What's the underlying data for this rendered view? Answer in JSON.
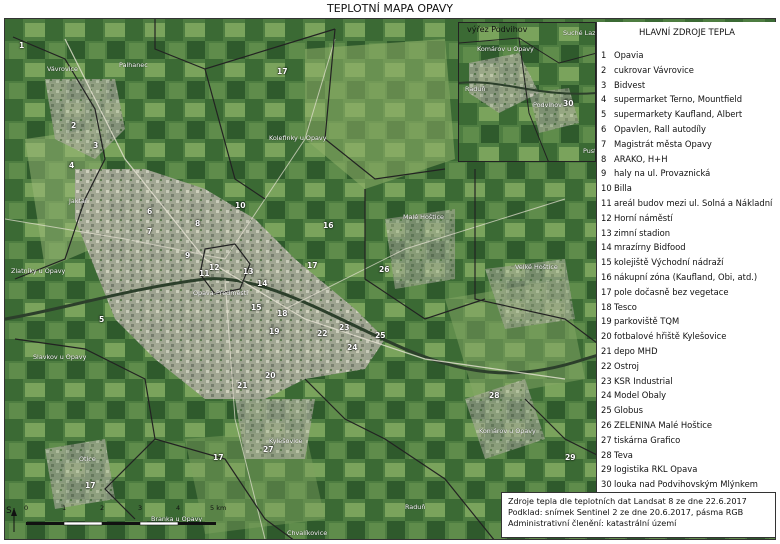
{
  "title": "TEPLOTNÍ MAPA OPAVY",
  "legend": {
    "title": "HLAVNÍ ZDROJE TEPLA",
    "items": [
      {
        "n": "1",
        "label": "Opavia"
      },
      {
        "n": "2",
        "label": "cukrovar Vávrovice"
      },
      {
        "n": "3",
        "label": "Bidvest"
      },
      {
        "n": "4",
        "label": "supermarket Terno, Mountfield"
      },
      {
        "n": "5",
        "label": "supermarkety Kaufland, Albert"
      },
      {
        "n": "6",
        "label": "Opavlen, Rall autodíly"
      },
      {
        "n": "7",
        "label": "Magistrát města Opavy"
      },
      {
        "n": "8",
        "label": "ARAKO, H+H"
      },
      {
        "n": "9",
        "label": "haly na ul. Provaznická"
      },
      {
        "n": "10",
        "label": "Billa"
      },
      {
        "n": "11",
        "label": "areál budov mezi ul. Solná a Nákladní"
      },
      {
        "n": "12",
        "label": "Horní náměstí"
      },
      {
        "n": "13",
        "label": "zimní stadion"
      },
      {
        "n": "14",
        "label": "mrazírny Bidfood"
      },
      {
        "n": "15",
        "label": "kolejiště Východní nádraží"
      },
      {
        "n": "16",
        "label": "nákupní zóna (Kaufland, Obi, atd.)"
      },
      {
        "n": "17",
        "label": "pole dočasně bez vegetace"
      },
      {
        "n": "18",
        "label": "Tesco"
      },
      {
        "n": "19",
        "label": "parkoviště TQM"
      },
      {
        "n": "20",
        "label": "fotbalové hřiště Kylešovice"
      },
      {
        "n": "21",
        "label": "depo MHD"
      },
      {
        "n": "22",
        "label": "Ostroj"
      },
      {
        "n": "23",
        "label": "KSR Industrial"
      },
      {
        "n": "24",
        "label": "Model Obaly"
      },
      {
        "n": "25",
        "label": "Globus"
      },
      {
        "n": "26",
        "label": "ZELENINA Malé Hoštice"
      },
      {
        "n": "27",
        "label": "tiskárna Grafico"
      },
      {
        "n": "28",
        "label": "Teva"
      },
      {
        "n": "29",
        "label": "logistika RKL Opava"
      },
      {
        "n": "30",
        "label": "louka nad Podvihovským Mlýnkem"
      }
    ]
  },
  "inset": {
    "title": "výřez Podvihov",
    "places": [
      "Komárov u Opavy",
      "Raduň",
      "Podvihov",
      "Suché Lazce",
      "Pust"
    ],
    "marker": "30"
  },
  "note": {
    "line1": "Zdroje tepla dle teplotních dat Landsat 8 ze dne 22.6.2017",
    "line2": "Podklad: snímek Sentinel 2 ze dne 20.6.2017, pásma RGB",
    "line3": "Administrativní členění: katastrální území"
  },
  "places": {
    "vavrovice": "Vávrovice",
    "palhanec": "Palhanec",
    "jaktar": "Jaktař",
    "kolerinky": "Kolefinky u Opavy",
    "male_hostice": "Malé Hoštice",
    "velke_hostice": "Velké Hoštice",
    "zlatniky": "Zlatníky u Opavy",
    "opava_predmesti": "Opava-Předměstí",
    "slavkov": "Slavkov u Opavy",
    "kylesovice": "Kylešovice",
    "komarov": "Komárov u Opavy",
    "otice": "Otice",
    "branka": "Branka u Opavy",
    "chvalikovice": "Chvalíkovice",
    "radun": "Raduň"
  },
  "markers": [
    "1",
    "2",
    "3",
    "4",
    "5",
    "6",
    "7",
    "8",
    "9",
    "10",
    "11",
    "12",
    "13",
    "14",
    "15",
    "16",
    "17",
    "17",
    "17",
    "17",
    "17",
    "18",
    "19",
    "20",
    "21",
    "22",
    "23",
    "24",
    "25",
    "26",
    "27",
    "28",
    "29"
  ],
  "scale": {
    "ticks": [
      "0",
      "1",
      "2",
      "3",
      "4",
      "5 km"
    ]
  },
  "north": "S",
  "colors": {
    "field_dark": "#2f5a2c",
    "field_light": "#6f9b53",
    "urban": "#b8b5a8",
    "boundary": "#222222",
    "road": "#e7e3d4"
  }
}
